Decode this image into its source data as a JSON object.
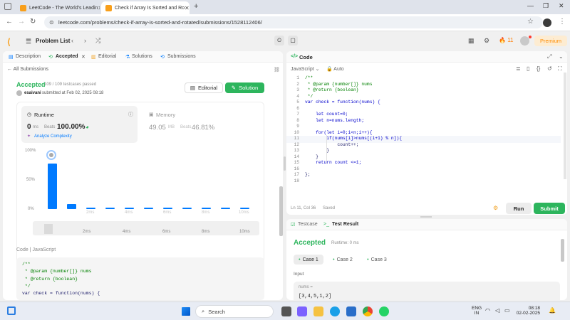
{
  "browser": {
    "tabs": [
      {
        "title": "LeetCode - The World's Leadin"
      },
      {
        "title": "Check if Array Is Sorted and Ro"
      }
    ],
    "url": "leetcode.com/problems/check-if-array-is-sorted-and-rotated/submissions/1528112406/"
  },
  "nav": {
    "problem_list": "Problem List",
    "streak": "11",
    "premium": "Premium"
  },
  "left": {
    "tabs": {
      "description": "Description",
      "accepted": "Accepted",
      "editorial": "Editorial",
      "solutions": "Solutions",
      "submissions": "Submissions"
    },
    "all_submissions": "All Submissions",
    "status": "Accepted",
    "passed": "109 / 109 testcases passed",
    "user": "esaivani",
    "submitted": "submitted at Feb 02, 2025 08:18",
    "editorial_btn": "Editorial",
    "solution_btn": "Solution",
    "runtime": {
      "label": "Runtime",
      "value": "0",
      "unit": "ms",
      "beats_label": "Beats",
      "beats": "100.00%",
      "analyze": "Analyze Complexity"
    },
    "memory": {
      "label": "Memory",
      "value": "49.05",
      "unit": "MB",
      "beats_label": "Beats",
      "beats": "46.81%"
    },
    "chart_data": {
      "type": "bar",
      "y_ticks": [
        "100%",
        "50%",
        "0%"
      ],
      "x_ticks": [
        "2ms",
        "4ms",
        "6ms",
        "8ms",
        "10ms"
      ],
      "values": [
        80,
        9,
        1,
        1,
        1,
        1,
        1,
        1,
        1,
        1,
        1
      ],
      "ylim": [
        0,
        100
      ]
    },
    "code_header": {
      "label": "Code",
      "lang": "JavaScript"
    },
    "code_preview": [
      "/**",
      " * @param {number[]} nums",
      " * @return {boolean}",
      " */",
      "var check = function(nums) {"
    ]
  },
  "editor": {
    "title": "Code",
    "lang": "JavaScript",
    "auto": "Auto",
    "status": "Ln 11, Col 36",
    "saved": "Saved",
    "run": "Run",
    "submit": "Submit",
    "lines": [
      {
        "n": "1",
        "t": "/**"
      },
      {
        "n": "2",
        "t": " * @param {number[]} nums"
      },
      {
        "n": "3",
        "t": " * @return {boolean}"
      },
      {
        "n": "4",
        "t": " */"
      },
      {
        "n": "5",
        "t": "var check = function(nums) {"
      },
      {
        "n": "6",
        "t": ""
      },
      {
        "n": "7",
        "t": "    let count=0;"
      },
      {
        "n": "8",
        "t": "    let n=nums.length;"
      },
      {
        "n": "9",
        "t": ""
      },
      {
        "n": "10",
        "t": "    for(let i=0;i<n;i++){"
      },
      {
        "n": "11",
        "t": "        if(nums[i]>nums[(i+1) % n]){"
      },
      {
        "n": "12",
        "t": "            count++;"
      },
      {
        "n": "13",
        "t": "        }"
      },
      {
        "n": "14",
        "t": "    }"
      },
      {
        "n": "15",
        "t": "    return count <=1;"
      },
      {
        "n": "16",
        "t": ""
      },
      {
        "n": "17",
        "t": "};"
      },
      {
        "n": "18",
        "t": ""
      }
    ]
  },
  "bottom": {
    "testcase": "Testcase",
    "test_result": "Test Result",
    "status": "Accepted",
    "runtime": "Runtime: 0 ms",
    "cases": [
      "Case 1",
      "Case 2",
      "Case 3"
    ],
    "input_label": "Input",
    "var": "nums =",
    "value": "[3,4,5,1,2]"
  },
  "taskbar": {
    "search": "Search",
    "lang1": "ENG",
    "lang2": "IN",
    "time": "08:18",
    "date": "02-02-2025"
  }
}
